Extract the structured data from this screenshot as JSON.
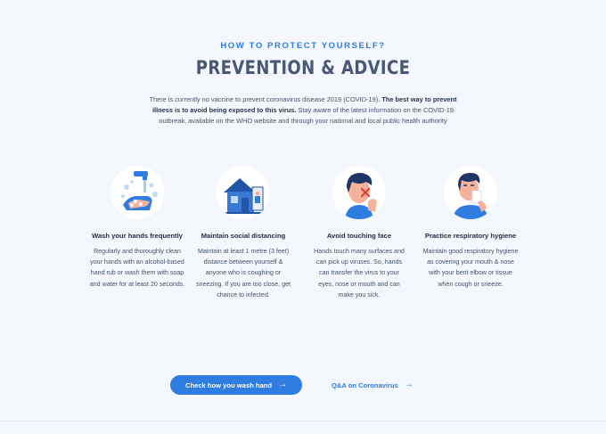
{
  "header": {
    "eyebrow": "HOW TO PROTECT YOURSELF?",
    "title": "PREVENTION & ADVICE"
  },
  "intro": {
    "lead": "There is currently no vaccine to prevent coronavirus disease 2019 (COVID-19).",
    "emphasis": "The best way to prevent illness is to avoid being exposed to this virus.",
    "rest": "Stay aware of the latest information on the COVID-19 outbreak, available on the WHO website and through your national and local public health authority"
  },
  "cards": [
    {
      "icon": "handwash-icon",
      "title": "Wash your hands frequently",
      "text": "Regularly and thoroughly clean your hands with an alcohol-based hand rub or wash them with soap and water for at least 20 seconds."
    },
    {
      "icon": "house-distancing-icon",
      "title": "Maintain social distancing",
      "text": "Maintain at least 1 metre (3 feet) distance between yourself & anyone who is coughing or sneezing. If you are too close, get chance to infected."
    },
    {
      "icon": "no-touch-face-icon",
      "title": "Avoid touching face",
      "text": "Hands touch many surfaces and can pick up viruses. So, hands can transfer the virus to your eyes, nose or mouth and can make you sick."
    },
    {
      "icon": "sneeze-tissue-icon",
      "title": "Practice respiratory hygiene",
      "text": "Maintain good respiratory hygiene as covering your mouth & nose with your bent elbow or tissue when cough or sneeze."
    }
  ],
  "actions": {
    "primary_label": "Check how you wash hand",
    "primary_icon": "arrow-right-icon",
    "secondary_label": "Q&A on Coronavirus",
    "secondary_icon": "arrow-right-icon"
  },
  "colors": {
    "accent": "#2f7de1",
    "heading": "#4a5878",
    "background": "#f4f7fd"
  }
}
